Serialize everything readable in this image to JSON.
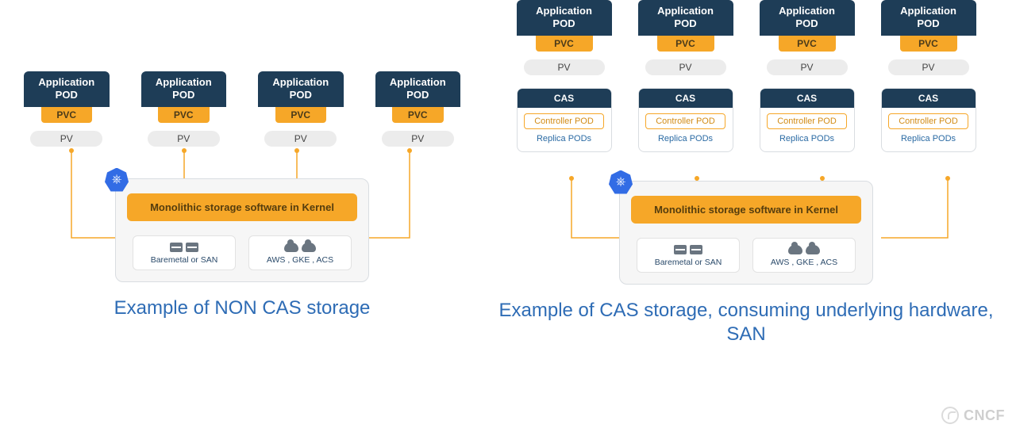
{
  "left": {
    "pods": [
      {
        "app": "Application\nPOD",
        "pvc": "PVC",
        "pv": "PV"
      },
      {
        "app": "Application\nPOD",
        "pvc": "PVC",
        "pv": "PV"
      },
      {
        "app": "Application\nPOD",
        "pvc": "PVC",
        "pv": "PV"
      },
      {
        "app": "Application\nPOD",
        "pvc": "PVC",
        "pv": "PV"
      }
    ],
    "kernel": "Monolithic storage software in Kernel",
    "infra": [
      {
        "label": "Baremetal or SAN",
        "icon": "server"
      },
      {
        "label": "AWS , GKE , ACS",
        "icon": "cloud"
      }
    ],
    "caption": "Example of NON CAS storage"
  },
  "right": {
    "pods": [
      {
        "app": "Application\nPOD",
        "pvc": "PVC",
        "pv": "PV",
        "cas": "CAS",
        "controller": "Controller POD",
        "replica": "Replica PODs"
      },
      {
        "app": "Application\nPOD",
        "pvc": "PVC",
        "pv": "PV",
        "cas": "CAS",
        "controller": "Controller POD",
        "replica": "Replica PODs"
      },
      {
        "app": "Application\nPOD",
        "pvc": "PVC",
        "pv": "PV",
        "cas": "CAS",
        "controller": "Controller POD",
        "replica": "Replica PODs"
      },
      {
        "app": "Application\nPOD",
        "pvc": "PVC",
        "pv": "PV",
        "cas": "CAS",
        "controller": "Controller POD",
        "replica": "Replica PODs"
      }
    ],
    "kernel": "Monolithic storage software in Kernel",
    "infra": [
      {
        "label": "Baremetal or SAN",
        "icon": "server"
      },
      {
        "label": "AWS , GKE , ACS",
        "icon": "cloud"
      }
    ],
    "caption": "Example of CAS storage, consuming underlying hardware, SAN"
  },
  "watermark": "CNCF",
  "colors": {
    "accent": "#f6a728",
    "primary": "#1e3d57",
    "link": "#2e6cb5",
    "k8s": "#326ce5"
  }
}
